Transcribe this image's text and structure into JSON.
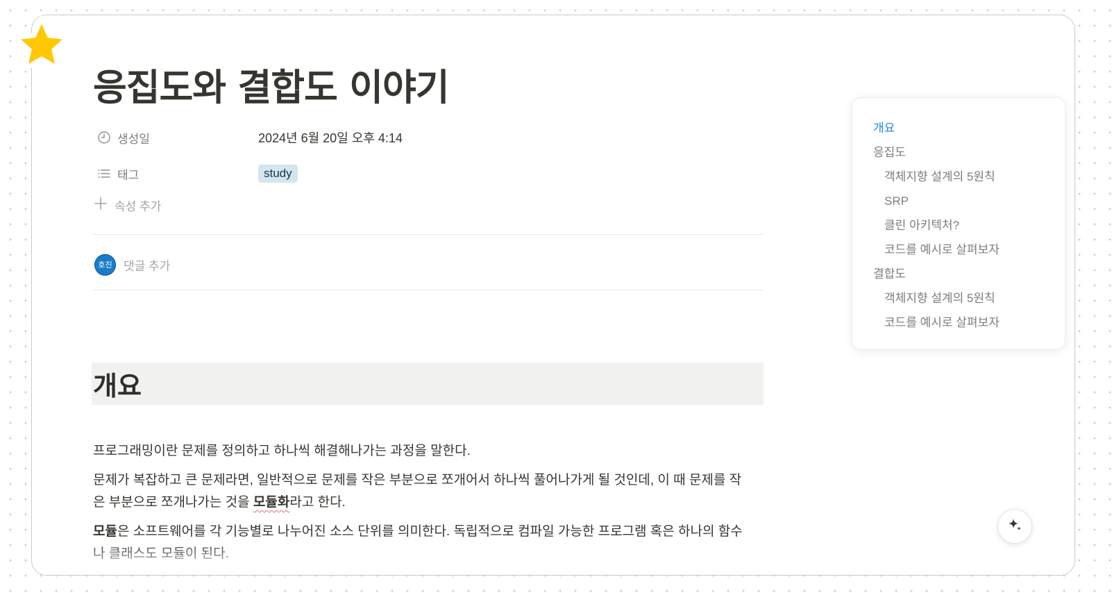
{
  "page": {
    "title": "응집도와 결합도 이야기",
    "properties": {
      "created": {
        "label": "생성일",
        "value": "2024년 6월 20일 오후 4:14",
        "icon": "clock-icon"
      },
      "tags": {
        "label": "태그",
        "value": "study",
        "icon": "list-icon",
        "tag_color": "#d3e5ef"
      }
    },
    "add_property_label": "속성 추가",
    "comment": {
      "avatar_text": "호진",
      "label": "댓글 추가"
    }
  },
  "content": {
    "heading": "개요",
    "paragraphs": {
      "p1": "프로그래밍이란 문제를 정의하고 하나씩 해결해나가는 과정을 말한다.",
      "p2_a": "문제가 복잡하고 큰 문제라면, 일반적으로 문제를 작은 부분으로 쪼개어서 하나씩 풀어나가게 될 것인데, 이 때 문제를 작은 부분으로 쪼개나가는 것을 ",
      "p2_bold": "모듈화",
      "p2_b": "라고 한다.",
      "p3_bold": "모듈",
      "p3_rest": "은 소프트웨어를 각 기능별로 나누어진 소스 단위를 의미한다. 독립적으로 컴파일 가능한 프로그램 혹은 하나의 함수나 클래스도 모듈이 된다."
    }
  },
  "toc": {
    "items": [
      {
        "label": "개요",
        "level": 1,
        "active": true
      },
      {
        "label": "응집도",
        "level": 1,
        "active": false
      },
      {
        "label": "객체지향 설계의 5원칙",
        "level": 2,
        "active": false
      },
      {
        "label": "SRP",
        "level": 2,
        "active": false
      },
      {
        "label": "클린 아키텍처?",
        "level": 2,
        "active": false
      },
      {
        "label": "코드를 예시로 살펴보자",
        "level": 2,
        "active": false
      },
      {
        "label": "결합도",
        "level": 1,
        "active": false
      },
      {
        "label": "객체지향 설계의 5원칙",
        "level": 2,
        "active": false
      },
      {
        "label": "코드를 예시로 살펴보자",
        "level": 2,
        "active": false
      }
    ]
  },
  "colors": {
    "accent": "#2383e2",
    "star": "#ffc800",
    "avatar": "#1a7cc9",
    "heading_bg": "#f1f1ef"
  },
  "icons": {
    "page_icon": "star-icon",
    "ai_button": "sparkle-icon",
    "add": "plus-icon"
  }
}
